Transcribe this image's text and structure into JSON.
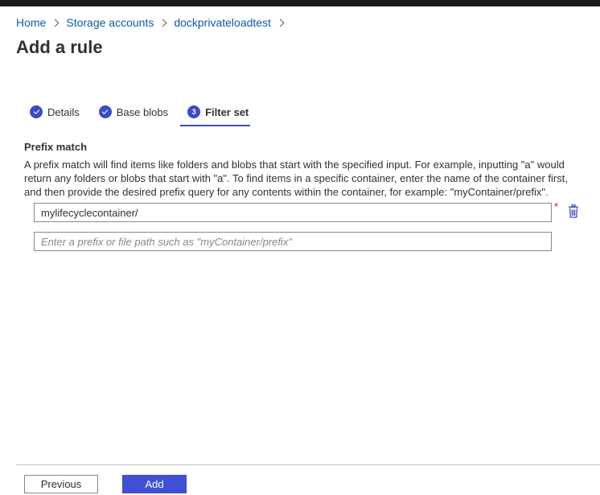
{
  "breadcrumb": {
    "items": [
      {
        "label": "Home"
      },
      {
        "label": "Storage accounts"
      },
      {
        "label": "dockprivateloadtest"
      }
    ]
  },
  "page": {
    "title": "Add a rule"
  },
  "tabs": [
    {
      "label": "Details",
      "state": "complete"
    },
    {
      "label": "Base blobs",
      "state": "complete"
    },
    {
      "label": "Filter set",
      "state": "active",
      "step": "3"
    }
  ],
  "prefix_match": {
    "title": "Prefix match",
    "description": "A prefix match will find items like folders and blobs that start with the specified input. For example, inputting \"a\" would return any folders or blobs that start with \"a\". To find items in a specific container, enter the name of the container first, and then provide the desired prefix query for any contents within the container, for example: \"myContainer/prefix\".",
    "required_mark": "*",
    "entries": [
      {
        "value": "mylifecyclecontainer/"
      }
    ],
    "new_entry_placeholder": "Enter a prefix or file path such as \"myContainer/prefix\""
  },
  "footer": {
    "previous_label": "Previous",
    "add_label": "Add"
  },
  "colors": {
    "accent": "#4050d4",
    "link": "#0f5ba8",
    "required": "#a4262c"
  },
  "icons": {
    "delete": "trash-icon",
    "complete_step": "checkmark-icon",
    "breadcrumb_separator": "chevron-right-icon"
  }
}
